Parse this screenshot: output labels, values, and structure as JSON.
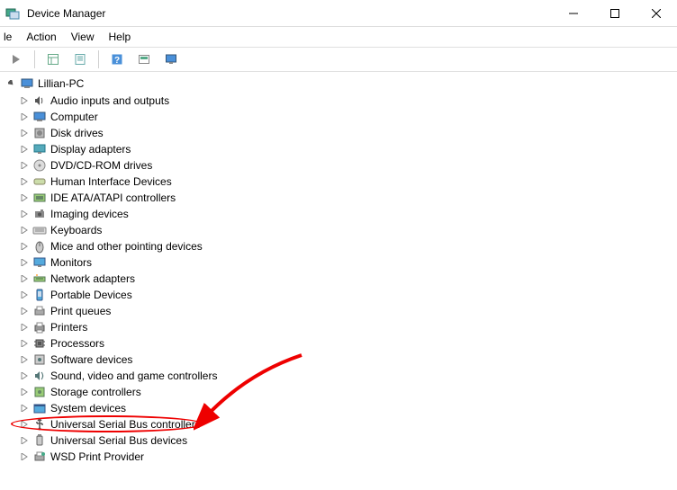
{
  "window": {
    "title": "Device Manager"
  },
  "menu": {
    "file": "le",
    "action": "Action",
    "view": "View",
    "help": "Help"
  },
  "root": {
    "name": "Lillian-PC"
  },
  "nodes": [
    {
      "label": "Audio inputs and outputs",
      "icon": "speaker"
    },
    {
      "label": "Computer",
      "icon": "monitor"
    },
    {
      "label": "Disk drives",
      "icon": "disk"
    },
    {
      "label": "Display adapters",
      "icon": "display"
    },
    {
      "label": "DVD/CD-ROM drives",
      "icon": "disc"
    },
    {
      "label": "Human Interface Devices",
      "icon": "hid"
    },
    {
      "label": "IDE ATA/ATAPI controllers",
      "icon": "ide"
    },
    {
      "label": "Imaging devices",
      "icon": "camera"
    },
    {
      "label": "Keyboards",
      "icon": "keyboard"
    },
    {
      "label": "Mice and other pointing devices",
      "icon": "mouse"
    },
    {
      "label": "Monitors",
      "icon": "monitor2"
    },
    {
      "label": "Network adapters",
      "icon": "network"
    },
    {
      "label": "Portable Devices",
      "icon": "portable"
    },
    {
      "label": "Print queues",
      "icon": "printq"
    },
    {
      "label": "Printers",
      "icon": "printer"
    },
    {
      "label": "Processors",
      "icon": "cpu"
    },
    {
      "label": "Software devices",
      "icon": "software"
    },
    {
      "label": "Sound, video and game controllers",
      "icon": "sound"
    },
    {
      "label": "Storage controllers",
      "icon": "storage"
    },
    {
      "label": "System devices",
      "icon": "system"
    },
    {
      "label": "Universal Serial Bus controllers",
      "icon": "usb"
    },
    {
      "label": "Universal Serial Bus devices",
      "icon": "usbdev"
    },
    {
      "label": "WSD Print Provider",
      "icon": "wsd"
    }
  ],
  "annotation": {
    "highlighted_index": 20
  }
}
